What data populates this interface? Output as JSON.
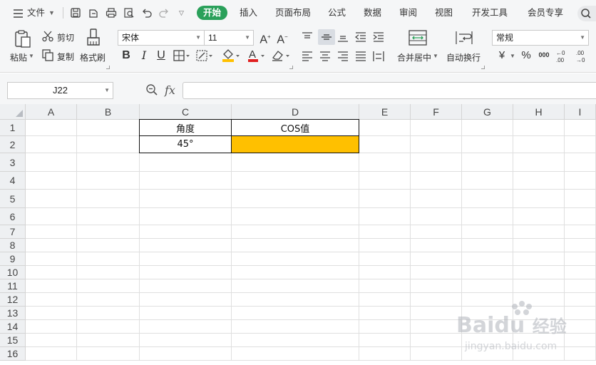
{
  "menubar": {
    "hamburger_label": "文件",
    "tabs": [
      "开始",
      "插入",
      "页面布局",
      "公式",
      "数据",
      "审阅",
      "视图",
      "开发工具",
      "会员专享"
    ]
  },
  "ribbon": {
    "paste_label": "粘贴",
    "cut_label": "剪切",
    "copy_label": "复制",
    "format_painter_label": "格式刷",
    "font_name": "宋体",
    "font_size": "11",
    "merge_center_label": "合并居中",
    "wrap_text_label": "自动换行",
    "number_format": "常规",
    "bold": "B",
    "italic": "I",
    "underline": "U",
    "currency_symbol": "¥",
    "percent_symbol": "%",
    "thousands_symbol": "000",
    "font_color": "#e02020",
    "fill_color": "#ffc000"
  },
  "formula_bar": {
    "name_box": "J22",
    "fx_label": "fx",
    "formula": ""
  },
  "sheet": {
    "columns": [
      "A",
      "B",
      "C",
      "D",
      "E",
      "F",
      "G",
      "H",
      "I"
    ],
    "rows": [
      "1",
      "2",
      "3",
      "4",
      "5",
      "6",
      "7",
      "8",
      "9",
      "10",
      "11",
      "12",
      "13",
      "14",
      "15",
      "16"
    ],
    "cells": {
      "C1": "角度",
      "D1": "COS值",
      "C2": "45°",
      "D2": ""
    },
    "highlight_color": "#ffc000"
  },
  "watermark": {
    "brand": "Bai",
    "brand_suffix": "du",
    "brand_cn": "经验",
    "url": "jingyan.baidu.com"
  }
}
